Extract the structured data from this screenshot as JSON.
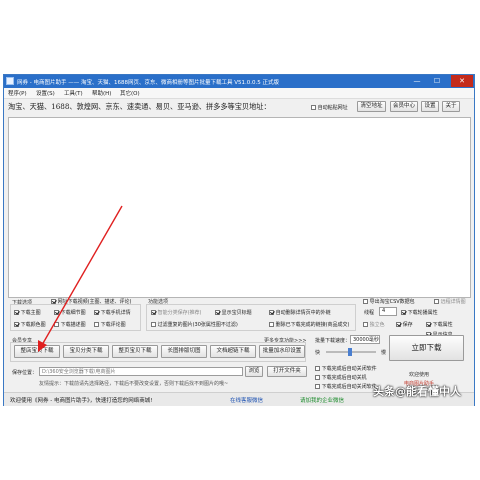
{
  "window": {
    "title": "网券 - 电商图片助手 —— 淘宝、天猫、1688网页、京东、微商相册等图片批量下载工具 V51.0.0.5 正式版",
    "minimize": "—",
    "maximize": "☐",
    "close": "✕"
  },
  "menu": [
    {
      "label": "程序(P)"
    },
    {
      "label": "设置(S)"
    },
    {
      "label": "工具(T)"
    },
    {
      "label": "帮助(H)"
    },
    {
      "label": "其它(O)"
    }
  ],
  "url_row": {
    "label": "淘宝、天猫、1688、敦煌网、京东、速卖通、易贝、亚马逊、拼多多等宝贝地址：",
    "auto_paste": "自动粘贴网址",
    "clear_button": "清空地址",
    "member_button": "会员中心",
    "settings_button": "设置",
    "about_button": "关于"
  },
  "download_options": {
    "title": "下载选项",
    "items": [
      {
        "label": "网址下载视频(主图、描述、评论)",
        "checked": true
      },
      {
        "label": "下载主图",
        "checked": true
      },
      {
        "label": "下载细节图",
        "checked": true
      },
      {
        "label": "下载手机详情",
        "checked": true
      },
      {
        "label": "下载颜色图",
        "checked": true
      },
      {
        "label": "下载描述图",
        "checked": false
      },
      {
        "label": "下载评论图",
        "checked": false
      }
    ]
  },
  "function_options": {
    "title": "功能选项",
    "items": [
      {
        "label": "智能分类保存(推荐)",
        "checked": true
      },
      {
        "label": "显示宝贝标题",
        "checked": true
      },
      {
        "label": "自动删除详情页中的外链",
        "checked": true
      },
      {
        "label": "过滤重复的图片(30张属性图不过滤)",
        "checked": false
      },
      {
        "label": "删除已下载完成的链接(商品成交)",
        "checked": false
      }
    ]
  },
  "right_options": {
    "export_csv": "导出淘宝CSV数据包",
    "threads_label": "线程",
    "threads_value": "4",
    "single_thread": "独立色",
    "save_format": "保存",
    "items": [
      {
        "label": "远程详情图",
        "checked": false
      },
      {
        "label": "下载轮播属性",
        "checked": true
      },
      {
        "label": "下载属性",
        "checked": true
      },
      {
        "label": "显示信息",
        "checked": true
      }
    ]
  },
  "exclusive": {
    "title": "会员专享",
    "more_label": "更多专享功能>>>",
    "buttons": [
      "整店宝贝下载",
      "宝贝分类下载",
      "整页宝贝下载",
      "长图排版切图",
      "文档超链下载",
      "批量加水印设置"
    ]
  },
  "speed": {
    "label": "批量下载速度：",
    "value": "30000毫秒",
    "fast": "快",
    "slow": "慢"
  },
  "start_button": "立即下载",
  "save": {
    "label": "保存位置：",
    "path": "D:\\360安全浏览器下载\\电商图片",
    "tip": "友情提示：下载前请先选择路径，下载后不要改变设置，否则下载后找不到图片的哦~",
    "browse_button": "浏览",
    "open_button": "打开文件夹"
  },
  "after_download": [
    {
      "label": "下载完成后自动关闭软件",
      "checked": false
    },
    {
      "label": "下载完成后自动关机",
      "checked": false
    },
    {
      "label": "下载完成后自动关闭软件",
      "checked": false
    }
  ],
  "user_panel": {
    "welcome": "欢迎使用",
    "subtitle": "电商图片助手"
  },
  "statusbar": {
    "left": "欢迎使用《网券 - 电商图片助手》，快速打造您的网络商城!",
    "online": "在线客服微信",
    "enterprise": "请加我的企业微信"
  },
  "watermark": "头条@能看懂中人",
  "colors": {
    "title_blue": "#2a6fc9",
    "annotation_red": "#e02020",
    "status_blue": "#1a4fb0",
    "status_green": "#1a8a2a"
  }
}
